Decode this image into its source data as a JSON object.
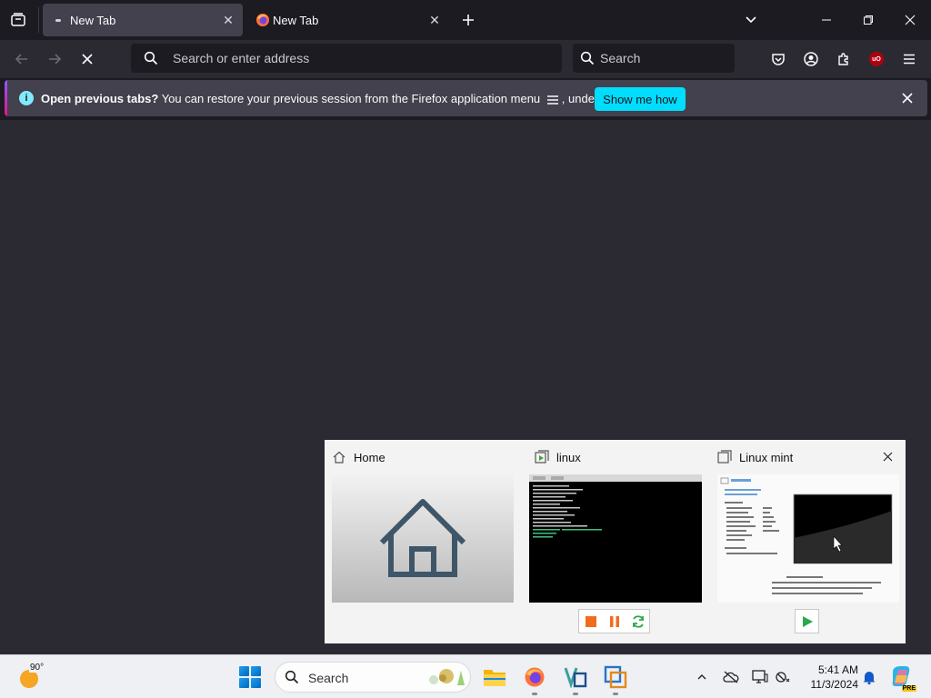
{
  "browser": {
    "tabs": [
      {
        "title": "New Tab",
        "active": true
      },
      {
        "title": "New Tab",
        "active": false
      }
    ],
    "urlbar_placeholder": "Search or enter address",
    "searchbar_placeholder": "Search",
    "accent_color": "#00ddff"
  },
  "notification": {
    "bold_text": "Open previous tabs?",
    "text": "You can restore your previous session from the Firefox application menu",
    "text_after": ", under History.",
    "button_label": "Show me how"
  },
  "thumbnail_popup": {
    "cards": [
      {
        "title": "Home",
        "icon": "home-icon"
      },
      {
        "title": "linux",
        "icon": "vm-running-icon"
      },
      {
        "title": "Linux mint",
        "icon": "vm-icon"
      }
    ]
  },
  "taskbar": {
    "weather_temp": "90°",
    "search_label": "Search",
    "time": "5:41 AM",
    "date": "11/3/2024",
    "copilot_badge": "PRE"
  }
}
